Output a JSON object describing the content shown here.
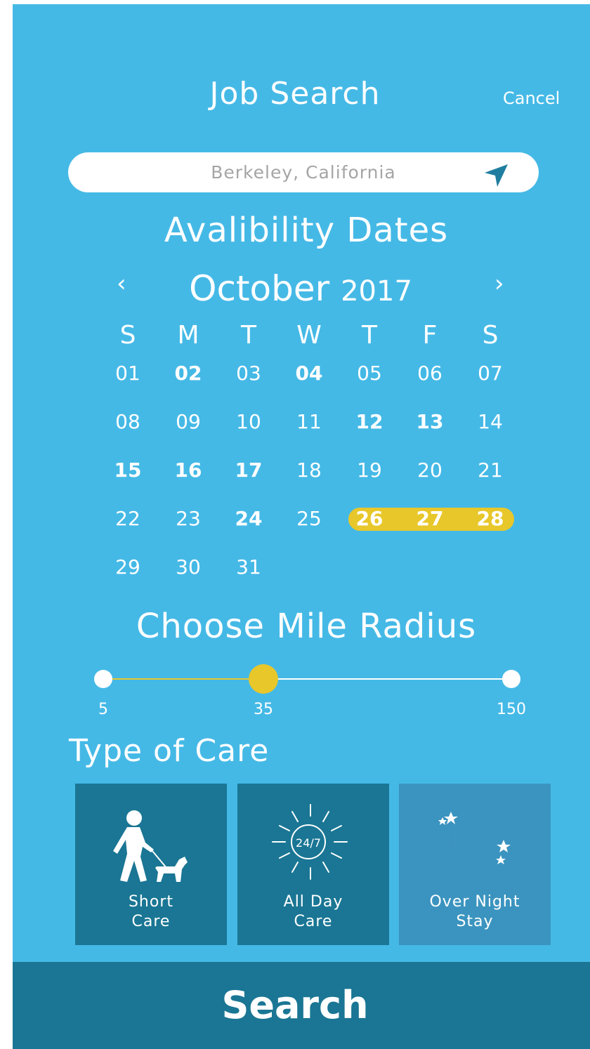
{
  "header": {
    "title": "Job Search",
    "cancel_label": "Cancel"
  },
  "location": {
    "value": "Berkeley, California"
  },
  "availability": {
    "title": "Avalibility Dates",
    "month": "October",
    "year": "2017",
    "prev_icon": "chevron-left-icon",
    "next_icon": "chevron-right-icon",
    "weekdays": [
      "S",
      "M",
      "T",
      "W",
      "T",
      "F",
      "S"
    ],
    "weeks": [
      [
        "01",
        "02",
        "03",
        "04",
        "05",
        "06",
        "07"
      ],
      [
        "08",
        "09",
        "10",
        "11",
        "12",
        "13",
        "14"
      ],
      [
        "15",
        "16",
        "17",
        "18",
        "19",
        "20",
        "21"
      ],
      [
        "22",
        "23",
        "24",
        "25",
        "26",
        "27",
        "28"
      ],
      [
        "29",
        "30",
        "31"
      ]
    ],
    "bold_days": [
      "02",
      "04",
      "12",
      "13",
      "15",
      "16",
      "17",
      "24",
      "26",
      "27",
      "28"
    ],
    "selected_range": [
      "26",
      "28"
    ],
    "highlight_color": "#e8c72a"
  },
  "radius": {
    "title": "Choose Mile Radius",
    "min": "5",
    "value": "35",
    "max": "150",
    "fill_color": "#e8c72a"
  },
  "care": {
    "title": "Type of Care",
    "options": [
      {
        "line1": "Short",
        "line2": "Care",
        "icon": "person-walking-dog-icon",
        "selected": true
      },
      {
        "line1": "All Day",
        "line2": "Care",
        "icon": "sun-24-7-icon",
        "selected": true
      },
      {
        "line1": "Over Night",
        "line2": "Stay",
        "icon": "moon-stars-icon",
        "selected": false
      }
    ],
    "selected_color": "#1a7694",
    "unselected_color": "#3b94bf"
  },
  "search": {
    "label": "Search"
  }
}
